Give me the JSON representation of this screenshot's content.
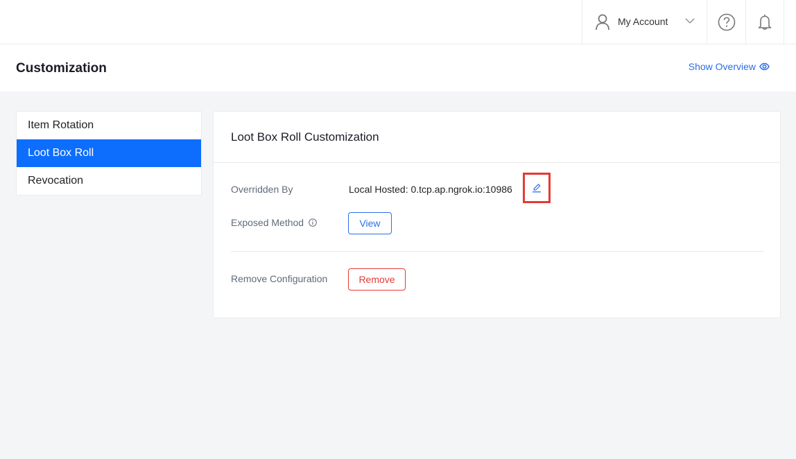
{
  "topbar": {
    "account_label": "My Account",
    "icons": [
      "user-icon",
      "chevron-down-icon",
      "help-icon",
      "bell-icon"
    ]
  },
  "header": {
    "title": "Customization",
    "show_overview_label": "Show Overview",
    "show_overview_icon": "eye-icon"
  },
  "sidebar": {
    "items": [
      {
        "label": "Item Rotation",
        "active": false
      },
      {
        "label": "Loot Box Roll",
        "active": true
      },
      {
        "label": "Revocation",
        "active": false
      }
    ]
  },
  "card": {
    "title": "Loot Box Roll Customization",
    "overridden_by": {
      "label": "Overridden By",
      "value": "Local Hosted: 0.tcp.ap.ngrok.io:10986",
      "edit_icon": "pencil-icon"
    },
    "exposed_method": {
      "label": "Exposed Method",
      "info_icon": "info-icon",
      "button_label": "View"
    },
    "remove_configuration": {
      "label": "Remove Configuration",
      "button_label": "Remove"
    }
  },
  "colors": {
    "accent": "#0d6efd",
    "link": "#2a6ee8",
    "danger": "#e53935",
    "background": "#f4f5f7"
  }
}
